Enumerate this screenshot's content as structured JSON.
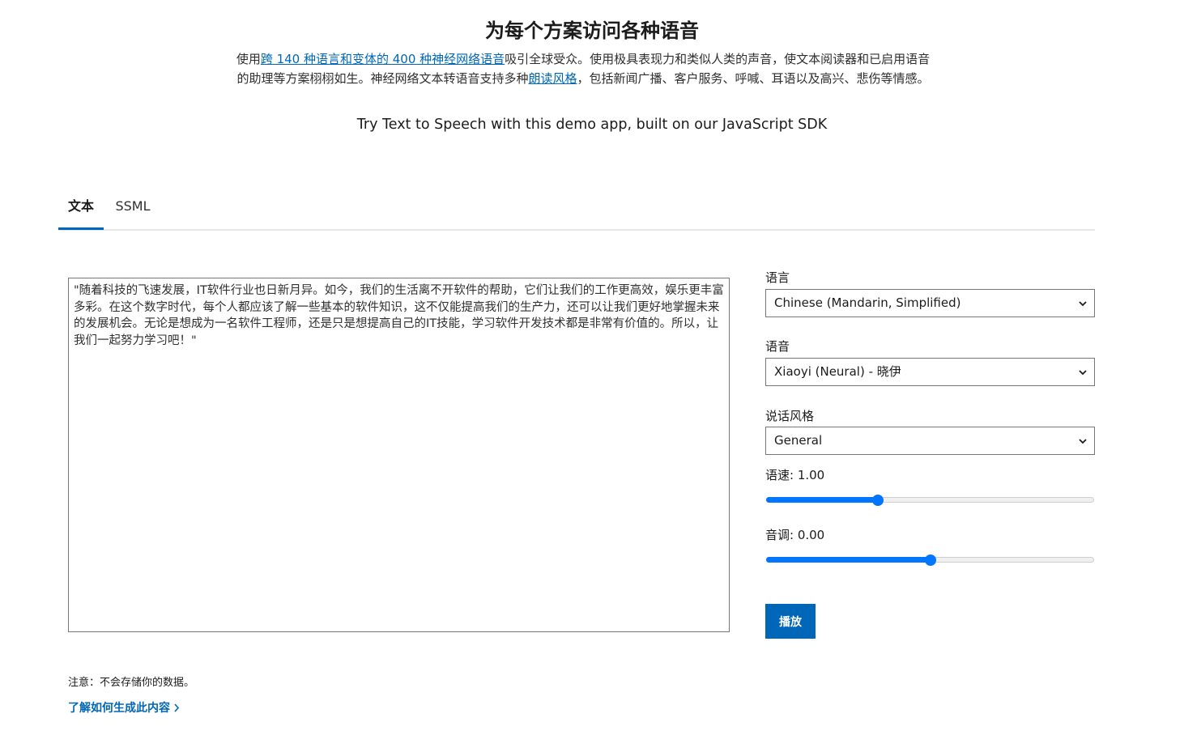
{
  "header": {
    "title": "为每个方案访问各种语音",
    "desc_prefix": "使用",
    "desc_link1": "跨 140 种语言和变体的 400 种神经网络语音",
    "desc_mid": "吸引全球受众。使用极具表现力和类似人类的声音，使文本阅读器和已启用语音的助理等方案栩栩如生。神经网络文本转语音支持多种",
    "desc_link2": "朗读风格",
    "desc_suffix": "，包括新闻广播、客户服务、呼喊、耳语以及高兴、悲伤等情感。",
    "subline": "Try Text to Speech with this demo app, built on our JavaScript SDK"
  },
  "tabs": [
    {
      "label": "文本",
      "active": true
    },
    {
      "label": "SSML",
      "active": false
    }
  ],
  "input_text": "\"随着科技的飞速发展，IT软件行业也日新月异。如今，我们的生活离不开软件的帮助，它们让我们的工作更高效，娱乐更丰富多彩。在这个数字时代，每个人都应该了解一些基本的软件知识，这不仅能提高我们的生产力，还可以让我们更好地掌握未来的发展机会。无论是想成为一名软件工程师，还是只是想提高自己的IT技能，学习软件开发技术都是非常有价值的。所以，让我们一起努力学习吧！\"",
  "settings": {
    "language_label": "语言",
    "language_value": "Chinese (Mandarin, Simplified)",
    "voice_label": "语音",
    "voice_value": "Xiaoyi (Neural) - 晓伊",
    "style_label": "说话风格",
    "style_value": "General",
    "rate_label": "语速: 1.00",
    "rate_fraction": 0.34,
    "pitch_label": "音调: 0.00",
    "pitch_fraction": 0.5
  },
  "play_label": "播放",
  "note": "注意：不会存储你的数据。",
  "learn_link": "了解如何生成此内容",
  "colors": {
    "accent": "#0067b8",
    "slider": "#0075ff"
  },
  "icons": {
    "select_chevron": "chevron-down-icon",
    "learn_chevron": "chevron-right-icon"
  }
}
